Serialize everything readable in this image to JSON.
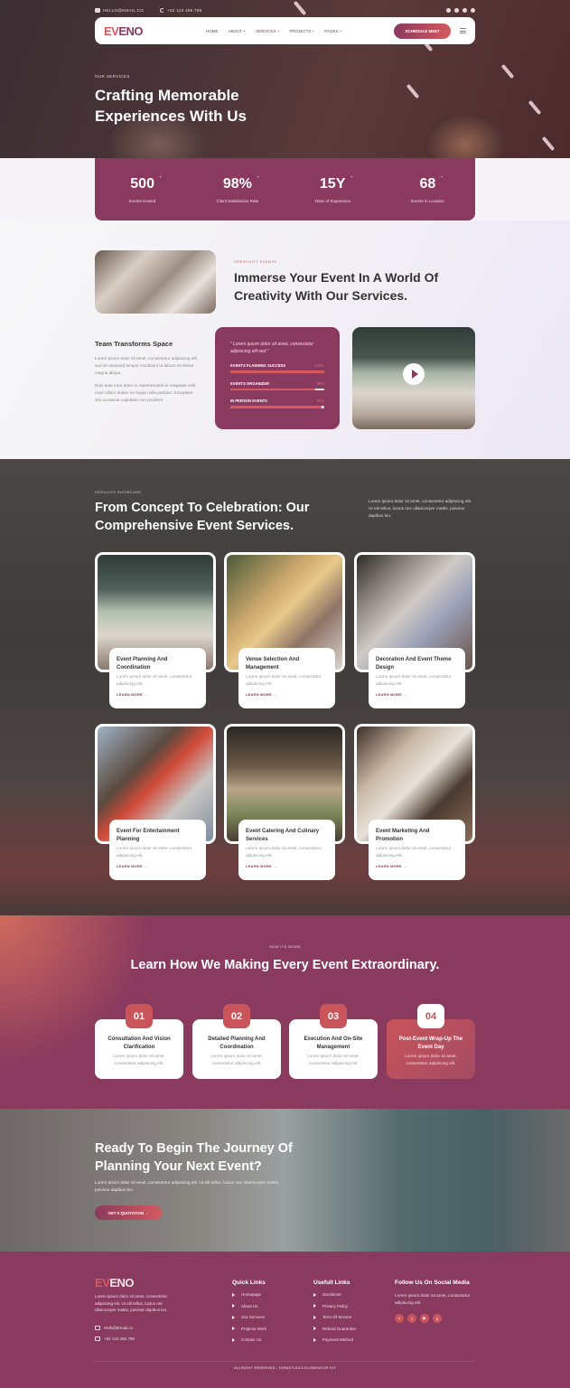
{
  "topbar": {
    "email": "HELLO@EMAIL.CO",
    "phone": "+62 123 456 789",
    "social_icons": [
      "facebook-icon",
      "twitter-icon",
      "youtube-icon",
      "pinterest-icon"
    ]
  },
  "nav": {
    "logo_accent": "EV",
    "logo_rest": "ENO",
    "items": [
      {
        "label": "HOME"
      },
      {
        "label": "ABOUT +"
      },
      {
        "label": "SERVICES +"
      },
      {
        "label": "PROJECTS +"
      },
      {
        "label": "PAGES +"
      }
    ],
    "active_index": 2,
    "cta": "SCHEDULE MEET"
  },
  "hero": {
    "eyebrow": "OUR SERVICES",
    "title": "Crafting Memorable Experiences With Us"
  },
  "stats": [
    {
      "value": "500",
      "suffix": "+",
      "label": "Events Hosted"
    },
    {
      "value": "98%",
      "suffix": "+",
      "label": "Client Satisfaction Rate"
    },
    {
      "value": "15Y",
      "suffix": "+",
      "label": "Years of Experience"
    },
    {
      "value": "68",
      "suffix": "+",
      "label": "Events in Location"
    }
  ],
  "about": {
    "eyebrow": "CREATIVITY EVENTS",
    "title": "Immerse Your Event In A World Of Creativity With Our Services.",
    "subtitle": "Team Transforms Space",
    "para1": "Lorem ipsum dolor sit amet, consectetur adipiscing elit, sed do eiusmod tempor incididunt ut labore et dolore magna aliqua.",
    "para2": "Duis aute irure dolor in reprehenderit in voluptate velit esse cillum dolore eu fugiat nulla pariatur. Excepteur sint occaecat cupidatat non proident",
    "quote": "\" Lorem ipsum dolor sit amet, consectetur adipiscing elit sed \"",
    "skills": [
      {
        "label": "EVENTS PLANNING SUCCESS",
        "percent": 100,
        "percent_text": "100%"
      },
      {
        "label": "EVENTS ORGANIZER",
        "percent": 90,
        "percent_text": "90%"
      },
      {
        "label": "IN PERSON EVENTS",
        "percent": 97,
        "percent_text": "97%"
      }
    ]
  },
  "services": {
    "eyebrow": "SERVICES SHOWCASE",
    "title": "From Concept To Celebration: Our Comprehensive Event Services.",
    "description": "Lorem ipsum dolor sit amet, consectetur adipiscing elit. Ut elit tellus, luctus nec ullamcorper mattis, pulvinar dapibus leo.",
    "cards": [
      {
        "title": "Event Planning And Coordination",
        "text": "Lorem ipsum dolor sit amet, consectetur adipiscing elit.",
        "link": "LEARN MORE →"
      },
      {
        "title": "Venue Selection And Management",
        "text": "Lorem ipsum dolor sit amet, consectetur adipiscing elit.",
        "link": "LEARN MORE →"
      },
      {
        "title": "Decoration And Event Theme Design",
        "text": "Lorem ipsum dolor sit amet, consectetur adipiscing elit.",
        "link": "LEARN MORE →"
      },
      {
        "title": "Event For Entertainment Planning",
        "text": "Lorem ipsum dolor sit amet, consectetur adipiscing elit.",
        "link": "LEARN MORE →"
      },
      {
        "title": "Event Catering And Culinary Services",
        "text": "Lorem ipsum dolor sit amet, consectetur adipiscing elit.",
        "link": "LEARN MORE →"
      },
      {
        "title": "Event Marketing And Promotion",
        "text": "Lorem ipsum dolor sit amet, consectetur adipiscing elit.",
        "link": "LEARN MORE →"
      }
    ]
  },
  "how": {
    "eyebrow": "HOW ITS WORK",
    "title": "Learn How We Making Every Event Extraordinary.",
    "steps": [
      {
        "num": "01",
        "title": "Consultation And Vision Clarification",
        "text": "Lorem ipsum dolor sit amet, consectetur adipiscing elit."
      },
      {
        "num": "02",
        "title": "Detailed Planning And Coordination",
        "text": "Lorem ipsum dolor sit amet, consectetur adipiscing elit."
      },
      {
        "num": "03",
        "title": "Execution And On-Site Management",
        "text": "Lorem ipsum dolor sit amet, consectetur adipiscing elit."
      },
      {
        "num": "04",
        "title": "Post-Event Wrap-Up The Event Day",
        "text": "Lorem ipsum dolor sit amet, consectetur adipiscing elit."
      }
    ],
    "active_index": 3
  },
  "cta": {
    "title": "Ready To Begin The Journey Of Planning Your Next Event?",
    "text": "Lorem ipsum dolor sit amet, consectetur adipiscing elit. Ut elit tellus, luctus nec ullamcorper mattis, pulvinar dapibus leo.",
    "button": "GET A QUOTATION →"
  },
  "footer": {
    "logo_accent": "EV",
    "logo_rest": "ENO",
    "about": "Lorem ipsum dolor sit amet, consectetur adipiscing elit. Ut elit tellus, luctus nec ullamcorper mattis, pulvinar dapibus leo.",
    "email": "Hello@Email.co",
    "phone": "+62 123 456 789",
    "quick_links": {
      "heading": "Quick Links",
      "items": [
        "Homepage",
        "About Us",
        "Our Services",
        "Projects Work",
        "Contact Us"
      ]
    },
    "useful_links": {
      "heading": "Usefull Links",
      "items": [
        "Disclaimer",
        "Privacy Policy",
        "Term Of Service",
        "Refund Guarantee",
        "Payment Method"
      ]
    },
    "follow": {
      "heading": "Follow Us On Social Media",
      "text": "Lorem ipsum dolor sit amet, consectetur adipiscing elit.",
      "icons": [
        "f",
        "t",
        "▶",
        "p"
      ]
    },
    "copyright": "ALLRIGHT RESERVED - DIRASTUDIO ELEMENTOR KIT"
  },
  "colors": {
    "brand": "#8a3a5e",
    "accent": "#d45a5f"
  }
}
